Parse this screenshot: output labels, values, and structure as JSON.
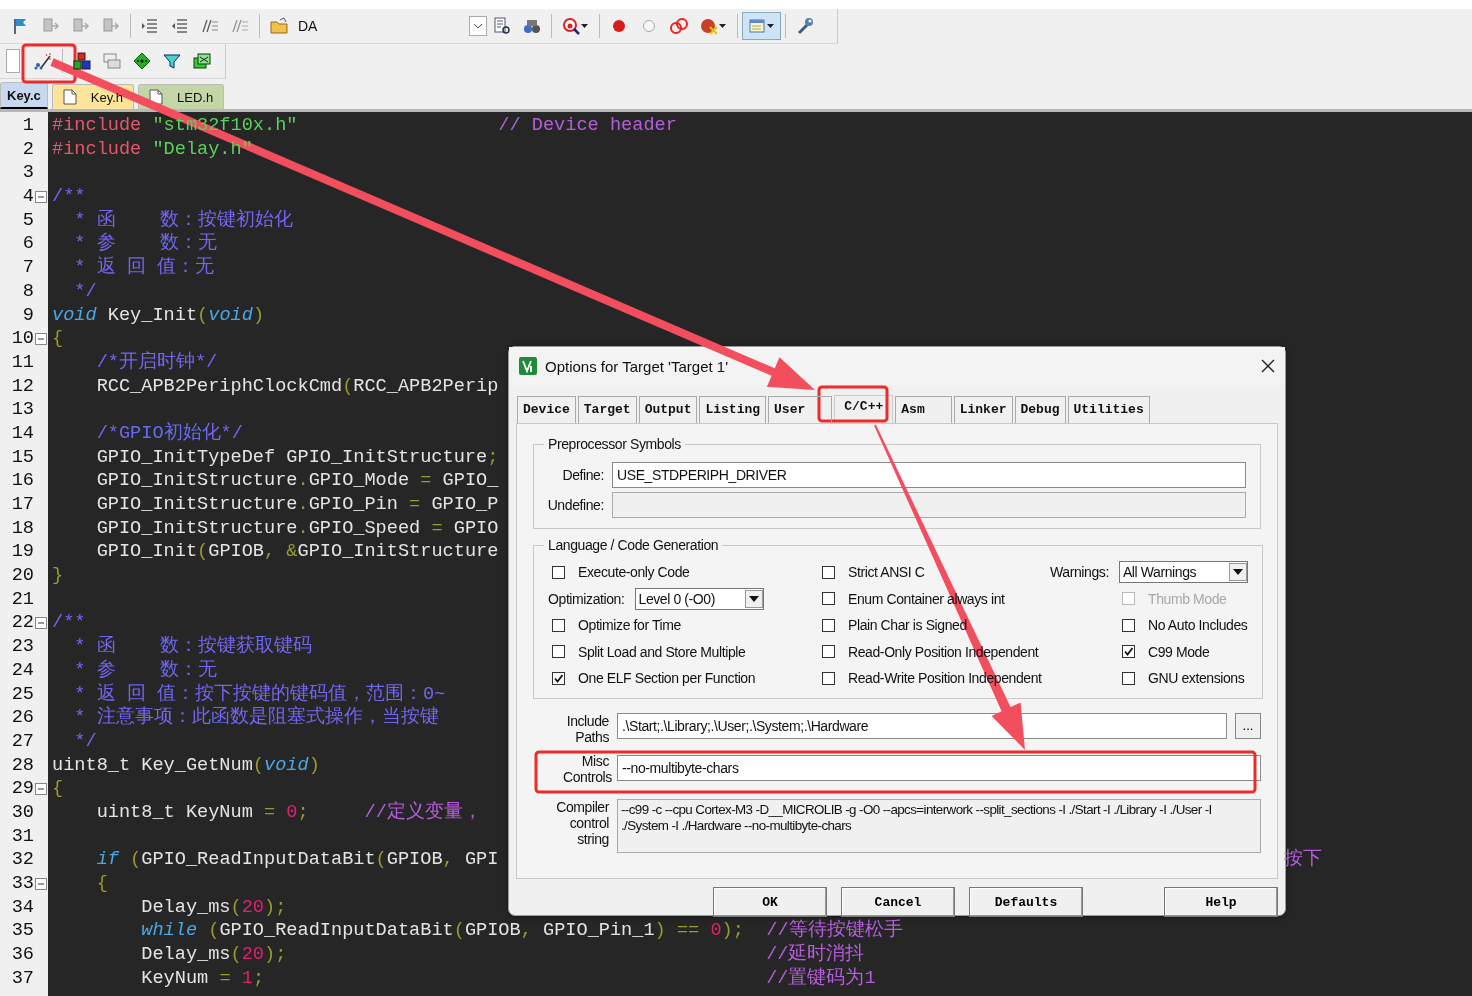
{
  "toolbar": {
    "config_label": "DA"
  },
  "file_tabs": [
    {
      "label": "Key.c",
      "selected": true,
      "color": "#c8d8ef"
    },
    {
      "label": "Key.h",
      "selected": false,
      "color": "#fde49a"
    },
    {
      "label": "LED.h",
      "selected": false,
      "color": "#c4d6a6"
    }
  ],
  "editor": {
    "lines": [
      {
        "number": "1",
        "tokens": [
          {
            "kind": "pp",
            "text": "#include"
          },
          {
            "kind": "str",
            "text": " \"stm32f10x.h\""
          },
          {
            "kind": "cmt",
            "text": "                  // Device header"
          }
        ]
      },
      {
        "number": "2",
        "tokens": [
          {
            "kind": "pp",
            "text": "#include"
          },
          {
            "kind": "str",
            "text": " \"Delay.h\""
          }
        ]
      },
      {
        "number": "3"
      },
      {
        "number": "4",
        "expanded": true,
        "tokens": [
          {
            "kind": "doc",
            "text": "/**"
          }
        ]
      },
      {
        "number": "5",
        "tokens": [
          {
            "kind": "doc",
            "text": "  * 函    数：按键初始化"
          }
        ]
      },
      {
        "number": "6",
        "tokens": [
          {
            "kind": "doc",
            "text": "  * 参    数：无"
          }
        ]
      },
      {
        "number": "7",
        "tokens": [
          {
            "kind": "doc",
            "text": "  * 返 回 值：无"
          }
        ]
      },
      {
        "number": "8",
        "tokens": [
          {
            "kind": "doc",
            "text": "  */"
          }
        ]
      },
      {
        "number": "9",
        "tokens": [
          {
            "kind": "kw",
            "text": "void"
          },
          {
            "kind": "txt",
            "text": " Key_Init"
          },
          {
            "kind": "punc",
            "text": "("
          },
          {
            "kind": "kw",
            "text": "void"
          },
          {
            "kind": "punc",
            "text": ")"
          }
        ]
      },
      {
        "number": "10",
        "expanded": true,
        "tokens": [
          {
            "kind": "punc",
            "text": "{"
          }
        ]
      },
      {
        "number": "11",
        "tokens": [
          {
            "kind": "doc",
            "text": "    /*开启时钟*/"
          }
        ]
      },
      {
        "number": "12",
        "tokens": [
          {
            "kind": "txt",
            "text": "    RCC_APB2PeriphClockCmd"
          },
          {
            "kind": "punc",
            "text": "("
          },
          {
            "kind": "txt",
            "text": "RCC_APB2Perip"
          }
        ]
      },
      {
        "number": "13"
      },
      {
        "number": "14",
        "tokens": [
          {
            "kind": "doc",
            "text": "    /*GPIO初始化*/"
          }
        ]
      },
      {
        "number": "15",
        "tokens": [
          {
            "kind": "txt",
            "text": "    GPIO_InitTypeDef GPIO_InitStructure"
          },
          {
            "kind": "punc",
            "text": ";"
          }
        ]
      },
      {
        "number": "16",
        "tokens": [
          {
            "kind": "txt",
            "text": "    GPIO_InitStructure"
          },
          {
            "kind": "punc",
            "text": "."
          },
          {
            "kind": "txt",
            "text": "GPIO_Mode"
          },
          {
            "kind": "punc",
            "text": " ="
          },
          {
            "kind": "txt",
            "text": " GPIO_"
          }
        ]
      },
      {
        "number": "17",
        "tokens": [
          {
            "kind": "txt",
            "text": "    GPIO_InitStructure"
          },
          {
            "kind": "punc",
            "text": "."
          },
          {
            "kind": "txt",
            "text": "GPIO_Pin"
          },
          {
            "kind": "punc",
            "text": " ="
          },
          {
            "kind": "txt",
            "text": " GPIO_P"
          }
        ]
      },
      {
        "number": "18",
        "tokens": [
          {
            "kind": "txt",
            "text": "    GPIO_InitStructure"
          },
          {
            "kind": "punc",
            "text": "."
          },
          {
            "kind": "txt",
            "text": "GPIO_Speed"
          },
          {
            "kind": "punc",
            "text": " ="
          },
          {
            "kind": "txt",
            "text": " GPIO"
          }
        ]
      },
      {
        "number": "19",
        "tokens": [
          {
            "kind": "txt",
            "text": "    GPIO_Init"
          },
          {
            "kind": "punc",
            "text": "("
          },
          {
            "kind": "txt",
            "text": "GPIOB"
          },
          {
            "kind": "punc",
            "text": ", &"
          },
          {
            "kind": "txt",
            "text": "GPIO_InitStructure"
          }
        ]
      },
      {
        "number": "20",
        "tokens": [
          {
            "kind": "punc",
            "text": "}"
          }
        ]
      },
      {
        "number": "21"
      },
      {
        "number": "22",
        "expanded": true,
        "tokens": [
          {
            "kind": "doc",
            "text": "/**"
          }
        ]
      },
      {
        "number": "23",
        "tokens": [
          {
            "kind": "doc",
            "text": "  * 函    数：按键获取键码"
          }
        ]
      },
      {
        "number": "24",
        "tokens": [
          {
            "kind": "doc",
            "text": "  * 参    数：无"
          }
        ]
      },
      {
        "number": "25",
        "tokens": [
          {
            "kind": "doc",
            "text": "  * 返 回 值：按下按键的键码值，范围：0~"
          }
        ]
      },
      {
        "number": "26",
        "tokens": [
          {
            "kind": "doc",
            "text": "  * 注意事项：此函数是阻塞式操作，当按键"
          }
        ]
      },
      {
        "number": "27",
        "tokens": [
          {
            "kind": "doc",
            "text": "  */"
          }
        ]
      },
      {
        "number": "28",
        "tokens": [
          {
            "kind": "txt",
            "text": "uint8_t Key_GetNum"
          },
          {
            "kind": "punc",
            "text": "("
          },
          {
            "kind": "kw",
            "text": "void"
          },
          {
            "kind": "punc",
            "text": ")"
          }
        ]
      },
      {
        "number": "29",
        "expanded": true,
        "tokens": [
          {
            "kind": "punc",
            "text": "{"
          }
        ]
      },
      {
        "number": "30",
        "tokens": [
          {
            "kind": "txt",
            "text": "    uint8_t KeyNum"
          },
          {
            "kind": "punc",
            "text": " ="
          },
          {
            "kind": "num",
            "text": " 0"
          },
          {
            "kind": "punc",
            "text": ";"
          },
          {
            "kind": "cmt",
            "text": "     //定义变量，"
          }
        ]
      },
      {
        "number": "31"
      },
      {
        "number": "32",
        "tokens": [
          {
            "kind": "kw",
            "text": "    if"
          },
          {
            "kind": "punc",
            "text": " ("
          },
          {
            "kind": "txt",
            "text": "GPIO_ReadInputDataBit"
          },
          {
            "kind": "punc",
            "text": "("
          },
          {
            "kind": "txt",
            "text": "GPIOB"
          },
          {
            "kind": "punc",
            "text": ","
          },
          {
            "kind": "txt",
            "text": " GPI"
          }
        ],
        "tail": "按下"
      },
      {
        "number": "33",
        "expanded": true,
        "tokens": [
          {
            "kind": "punc",
            "text": "    {"
          }
        ]
      },
      {
        "number": "34",
        "tokens": [
          {
            "kind": "txt",
            "text": "        Delay_ms"
          },
          {
            "kind": "punc",
            "text": "("
          },
          {
            "kind": "num",
            "text": "20"
          },
          {
            "kind": "punc",
            "text": ");"
          }
        ]
      },
      {
        "number": "35",
        "tokens": [
          {
            "kind": "kw",
            "text": "        while"
          },
          {
            "kind": "punc",
            "text": " ("
          },
          {
            "kind": "txt",
            "text": "GPIO_ReadInputDataBit"
          },
          {
            "kind": "punc",
            "text": "("
          },
          {
            "kind": "txt",
            "text": "GPIOB"
          },
          {
            "kind": "punc",
            "text": ","
          },
          {
            "kind": "txt",
            "text": " GPIO_Pin_1"
          },
          {
            "kind": "punc",
            "text": ") =="
          },
          {
            "kind": "num",
            "text": " 0"
          },
          {
            "kind": "punc",
            "text": ");"
          },
          {
            "kind": "cmt",
            "text": "  //等待按键松手"
          }
        ]
      },
      {
        "number": "36",
        "tokens": [
          {
            "kind": "txt",
            "text": "        Delay_ms"
          },
          {
            "kind": "punc",
            "text": "("
          },
          {
            "kind": "num",
            "text": "20"
          },
          {
            "kind": "punc",
            "text": ");"
          },
          {
            "kind": "cmt",
            "text": "                                           //延时消抖"
          }
        ]
      },
      {
        "number": "37",
        "tokens": [
          {
            "kind": "txt",
            "text": "        KeyNum"
          },
          {
            "kind": "punc",
            "text": " ="
          },
          {
            "kind": "num",
            "text": " 1"
          },
          {
            "kind": "punc",
            "text": ";"
          },
          {
            "kind": "cmt",
            "text": "                                             //置键码为1"
          }
        ]
      }
    ]
  },
  "dialog": {
    "title": "Options for Target 'Target 1'",
    "tabs": [
      {
        "label": "Device",
        "selected": false
      },
      {
        "label": "Target",
        "selected": false
      },
      {
        "label": "Output",
        "selected": false
      },
      {
        "label": "Listing",
        "selected": false
      },
      {
        "label": "User",
        "selected": false
      },
      {
        "label": "C/C++",
        "selected": true
      },
      {
        "label": "Asm",
        "selected": false
      },
      {
        "label": "Linker",
        "selected": false
      },
      {
        "label": "Debug",
        "selected": false
      },
      {
        "label": "Utilities",
        "selected": false
      }
    ],
    "preprocessor": {
      "title": "Preprocessor Symbols",
      "fields": [
        {
          "label": "Define:",
          "value": "USE_STDPERIPH_DRIVER",
          "disabled": false
        },
        {
          "label": "Undefine:",
          "disabled": true
        }
      ]
    },
    "language": {
      "title": "Language / Code Generation",
      "columns": [
        [
          {
            "kind": "checkbox",
            "label": "Execute-only Code",
            "checked": false,
            "disabled": false
          },
          {
            "kind": "select",
            "label": "Optimization:",
            "value": "Level 0 (-O0)"
          },
          {
            "kind": "checkbox",
            "label": "Optimize for Time",
            "checked": false,
            "disabled": false
          },
          {
            "kind": "checkbox",
            "label": "Split Load and Store Multiple",
            "checked": false,
            "disabled": false
          },
          {
            "kind": "checkbox",
            "label": "One ELF Section per Function",
            "checked": true,
            "disabled": false
          }
        ],
        [
          {
            "kind": "checkbox",
            "label": "Strict ANSI C",
            "checked": false,
            "disabled": false
          },
          {
            "kind": "checkbox",
            "label": "Enum Container always int",
            "checked": false,
            "disabled": false
          },
          {
            "kind": "checkbox",
            "label": "Plain Char is Signed",
            "checked": false,
            "disabled": false
          },
          {
            "kind": "checkbox",
            "label": "Read-Only Position Independent",
            "checked": false,
            "disabled": false
          },
          {
            "kind": "checkbox",
            "label": "Read-Write Position Independent",
            "checked": false,
            "disabled": false
          }
        ],
        [
          {
            "kind": "select",
            "label": "Warnings:",
            "value": "All Warnings"
          },
          {
            "kind": "checkbox",
            "label": "Thumb Mode",
            "checked": false,
            "disabled": true
          },
          {
            "kind": "checkbox",
            "label": "No Auto Includes",
            "checked": false,
            "disabled": false
          },
          {
            "kind": "checkbox",
            "label": "C99 Mode",
            "checked": true,
            "disabled": false
          },
          {
            "kind": "checkbox",
            "label": "GNU extensions",
            "checked": false,
            "disabled": false
          }
        ]
      ]
    },
    "include_paths": {
      "label": "Include Paths",
      "value": ".\\Start;.\\Library;.\\User;.\\System;.\\Hardware",
      "browse": "..."
    },
    "misc_controls": {
      "label": "Misc Controls",
      "value": "--no-multibyte-chars"
    },
    "compiler_string": {
      "label": "Compiler control string",
      "value": "--c99 -c --cpu Cortex-M3 -D__MICROLIB -g -O0 --apcs=interwork --split_sections -I ./Start -I ./Library -I ./User -I ./System -I ./Hardware --no-multibyte-chars"
    },
    "buttons": [
      "OK",
      "Cancel",
      "Defaults",
      "Help"
    ]
  }
}
